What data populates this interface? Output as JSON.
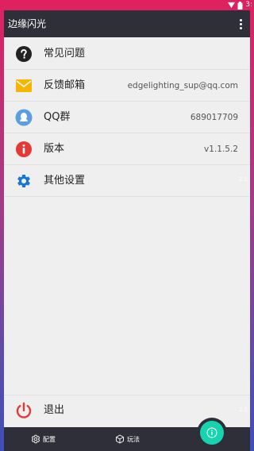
{
  "status_bar": {
    "time": "3:"
  },
  "app_bar": {
    "title": "边缘闪光",
    "overflow_icon": "more-vert-icon"
  },
  "menu": {
    "items": [
      {
        "label": "常见问题",
        "value": "",
        "icon": "help-icon",
        "icon_color": "#222222"
      },
      {
        "label": "反馈邮箱",
        "value": "edgelighting_sup@qq.com",
        "icon": "mail-icon",
        "icon_color": "#f7b500"
      },
      {
        "label": "QQ群",
        "value": "689017709",
        "icon": "qq-icon",
        "icon_color": "#5a9fe0"
      },
      {
        "label": "版本",
        "value": "v1.1.5.2",
        "icon": "info-icon",
        "icon_color": "#e53935"
      },
      {
        "label": "其他设置",
        "value": "",
        "icon": "gear-icon",
        "icon_color": "#1976d2"
      }
    ],
    "faded_text": "2.1"
  },
  "logout": {
    "label": "退出",
    "icon": "power-icon",
    "icon_color": "#e53935",
    "faded_text": "2.1"
  },
  "bottom_nav": {
    "items": [
      {
        "label": "配置",
        "icon": "gear-icon"
      },
      {
        "label": "玩法",
        "icon": "cube-icon"
      }
    ],
    "fab_icon": "info-icon",
    "fab_color": "#17d3ae"
  }
}
